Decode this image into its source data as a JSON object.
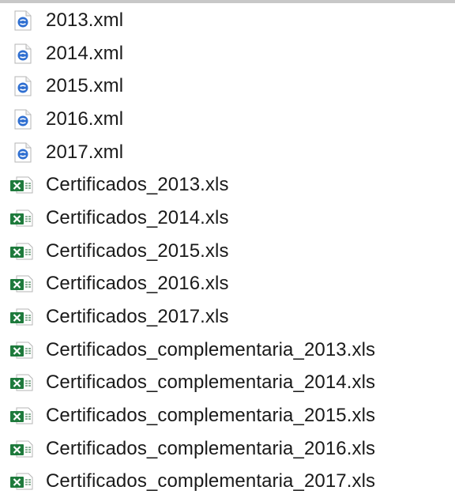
{
  "colors": {
    "xml_icon_blue": "#2f6fd1",
    "excel_icon_green": "#1e7a3c",
    "text": "#1a1a1a"
  },
  "files": [
    {
      "name": "2013.xml",
      "icon": "xml-file-icon"
    },
    {
      "name": "2014.xml",
      "icon": "xml-file-icon"
    },
    {
      "name": "2015.xml",
      "icon": "xml-file-icon"
    },
    {
      "name": "2016.xml",
      "icon": "xml-file-icon"
    },
    {
      "name": "2017.xml",
      "icon": "xml-file-icon"
    },
    {
      "name": "Certificados_2013.xls",
      "icon": "excel-file-icon"
    },
    {
      "name": "Certificados_2014.xls",
      "icon": "excel-file-icon"
    },
    {
      "name": "Certificados_2015.xls",
      "icon": "excel-file-icon"
    },
    {
      "name": "Certificados_2016.xls",
      "icon": "excel-file-icon"
    },
    {
      "name": "Certificados_2017.xls",
      "icon": "excel-file-icon"
    },
    {
      "name": "Certificados_complementaria_2013.xls",
      "icon": "excel-file-icon"
    },
    {
      "name": "Certificados_complementaria_2014.xls",
      "icon": "excel-file-icon"
    },
    {
      "name": "Certificados_complementaria_2015.xls",
      "icon": "excel-file-icon"
    },
    {
      "name": "Certificados_complementaria_2016.xls",
      "icon": "excel-file-icon"
    },
    {
      "name": "Certificados_complementaria_2017.xls",
      "icon": "excel-file-icon"
    }
  ]
}
